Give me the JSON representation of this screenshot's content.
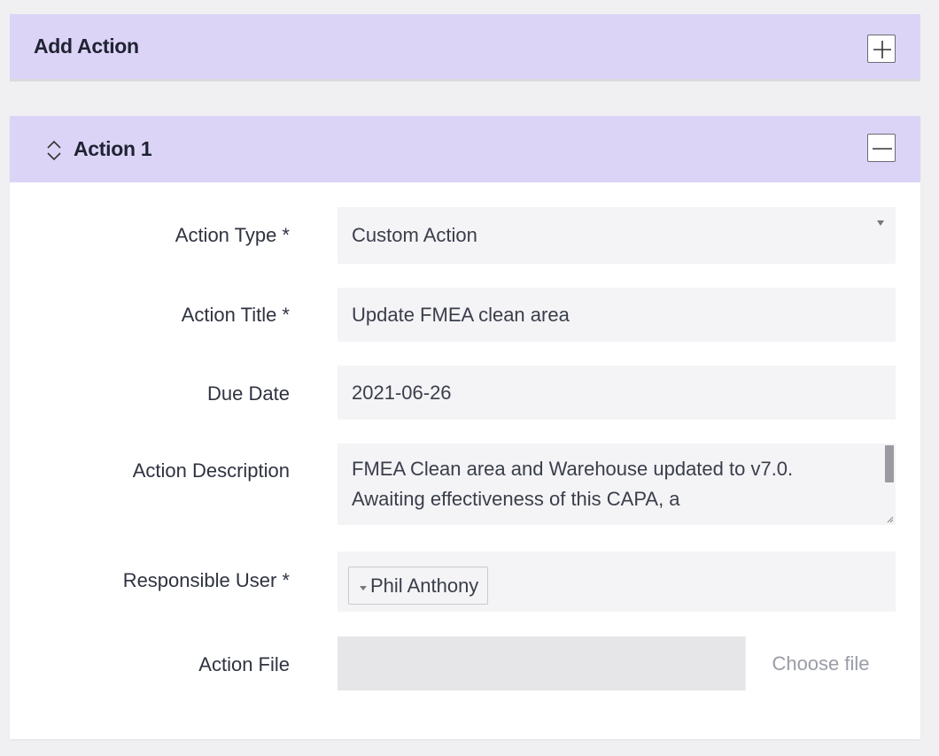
{
  "add_panel": {
    "title": "Add Action",
    "add_button_icon": "plus-icon"
  },
  "action": {
    "title": "Action 1",
    "collapse_icon": "chevron-up-down-icon",
    "minimize_button_icon": "minus-icon",
    "fields": {
      "action_type": {
        "label": "Action Type *",
        "value": "Custom Action"
      },
      "action_title": {
        "label": "Action Title *",
        "value": "Update FMEA clean area"
      },
      "due_date": {
        "label": "Due Date",
        "value": "2021-06-26"
      },
      "action_description": {
        "label": "Action Description",
        "value": "FMEA Clean area and Warehouse updated to v7.0. Awaiting effectiveness of this CAPA, a"
      },
      "responsible_user": {
        "label": "Responsible User *",
        "value": "Phil Anthony"
      },
      "action_file": {
        "label": "Action File",
        "button_label": "Choose file"
      }
    }
  },
  "colors": {
    "header_bg": "#dcd4f7",
    "field_bg": "#f4f4f6",
    "page_bg": "#f0f0f2"
  }
}
